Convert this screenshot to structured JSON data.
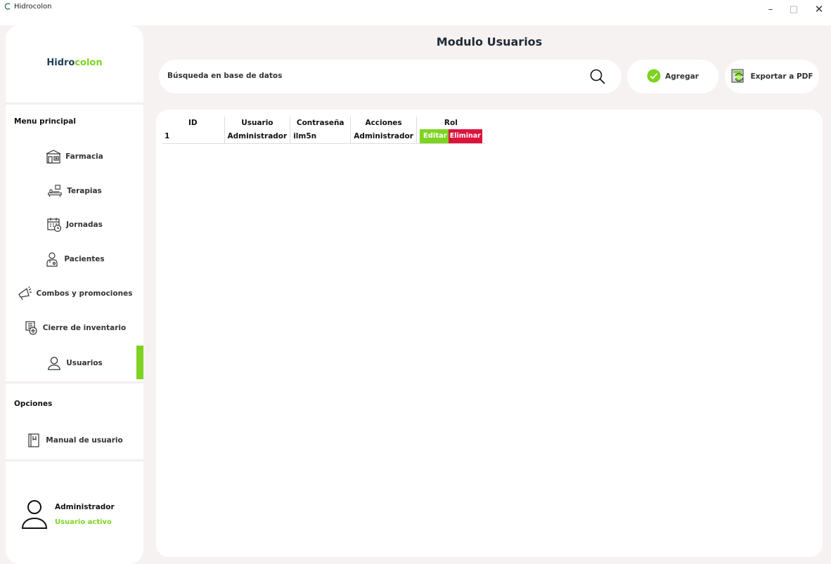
{
  "window": {
    "title": "Hidrocolon"
  },
  "brand": {
    "part1": "Hidro",
    "part2": "colon"
  },
  "sidebar": {
    "menu_title": "Menu principal",
    "items": [
      {
        "label": "Farmacia",
        "icon": "pharmacy-icon"
      },
      {
        "label": "Terapias",
        "icon": "therapy-bed-icon"
      },
      {
        "label": "Jornadas",
        "icon": "calendar-clock-icon"
      },
      {
        "label": "Pacientes",
        "icon": "patient-icon"
      },
      {
        "label": "Combos y promociones",
        "icon": "megaphone-icon"
      },
      {
        "label": "Cierre de inventario",
        "icon": "inventory-icon"
      },
      {
        "label": "Usuarios",
        "icon": "user-icon",
        "active": true
      }
    ],
    "options_title": "Opciones",
    "options": [
      {
        "label": "Manual de usuario",
        "icon": "book-icon"
      }
    ],
    "user": {
      "name": "Administrador",
      "status": "Usuario activo"
    }
  },
  "header": {
    "title": "Modulo Usuarios",
    "search_placeholder": "Búsqueda en base de datos",
    "add_label": "Agregar",
    "export_label": "Exportar a PDF"
  },
  "table": {
    "columns": [
      "ID",
      "Usuario",
      "Contraseña",
      "Acciones",
      "Rol"
    ],
    "rows": [
      {
        "id": "1",
        "usuario": "Administrador",
        "contrasena": "ilm5n",
        "rol": "Administrador",
        "edit_label": "Editar",
        "delete_label": "Eliminar"
      }
    ]
  },
  "colors": {
    "accent": "#7ed321",
    "danger": "#dc143c",
    "background": "#f6f2f1",
    "brand_dark": "#1f3f57"
  }
}
